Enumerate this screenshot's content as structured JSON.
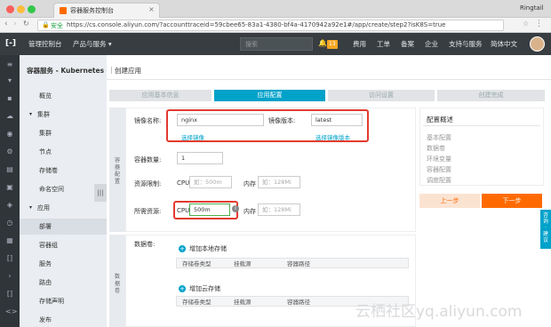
{
  "browser": {
    "tab_title": "容器服务控制台",
    "profile": "Ringtail",
    "secure_label": "安全",
    "url": "https://cs.console.aliyun.com/?accounttraceid=59cbee65-83a1-4380-bf4a-4170942a92e1#/app/create/step2?isK8S=true"
  },
  "topnav": {
    "console_home": "管理控制台",
    "products": "产品与服务 ▾",
    "search_placeholder": "搜索",
    "notif_badge": "13",
    "items": [
      "费用",
      "工单",
      "备案",
      "企业",
      "支持与服务",
      "简体中文"
    ]
  },
  "sidebar": {
    "title": "容器服务 - Kubernetes ▾",
    "items": [
      {
        "label": "概览"
      },
      {
        "label": "集群",
        "section": true
      },
      {
        "label": "集群"
      },
      {
        "label": "节点"
      },
      {
        "label": "存储卷"
      },
      {
        "label": "命名空间"
      },
      {
        "label": "应用",
        "section": true
      },
      {
        "label": "部署",
        "active": true
      },
      {
        "label": "容器组"
      },
      {
        "label": "服务"
      },
      {
        "label": "路由"
      },
      {
        "label": "存储声明"
      },
      {
        "label": "发布"
      }
    ],
    "collapse": "|||"
  },
  "page": {
    "title": "创建应用",
    "steps": [
      "应用基本信息",
      "应用配置",
      "访问设置",
      "创建完成"
    ],
    "active_step": 1
  },
  "form": {
    "section_label": "容器配置",
    "volume_section": "数据卷",
    "image_name_label": "镜像名称:",
    "image_name_value": "nginx",
    "image_version_label": "镜像版本:",
    "image_version_value": "latest",
    "select_image": "选择镜像",
    "select_image_version": "选择镜像版本",
    "replicas_label": "容器数量:",
    "replicas_value": "1",
    "limit_label": "资源限制:",
    "cpu_label": "CPU",
    "cpu_limit_placeholder": "如：500m",
    "mem_label": "内存",
    "mem_limit_placeholder": "如：128Mi",
    "request_label": "所需资源:",
    "cpu_request_value": "500m",
    "mem_request_placeholder": "如：128Mi",
    "volumes_label": "数据卷:",
    "add_local": "增加本地存储",
    "add_cloud": "增加云存储",
    "vol_cols_local": [
      "存储卷类型",
      "挂载源",
      "容器路径"
    ],
    "vol_cols_cloud": [
      "存储卷类型",
      "挂载源",
      "容器路径"
    ]
  },
  "summary": {
    "title": "配置概述",
    "items": [
      "基本配置",
      "数据卷",
      "环境变量",
      "容器配置",
      "调度配置"
    ],
    "prev": "上一步",
    "next": "下一步"
  },
  "float_tab": "咨询·建议",
  "watermark": "云栖社区yq.aliyun.com"
}
